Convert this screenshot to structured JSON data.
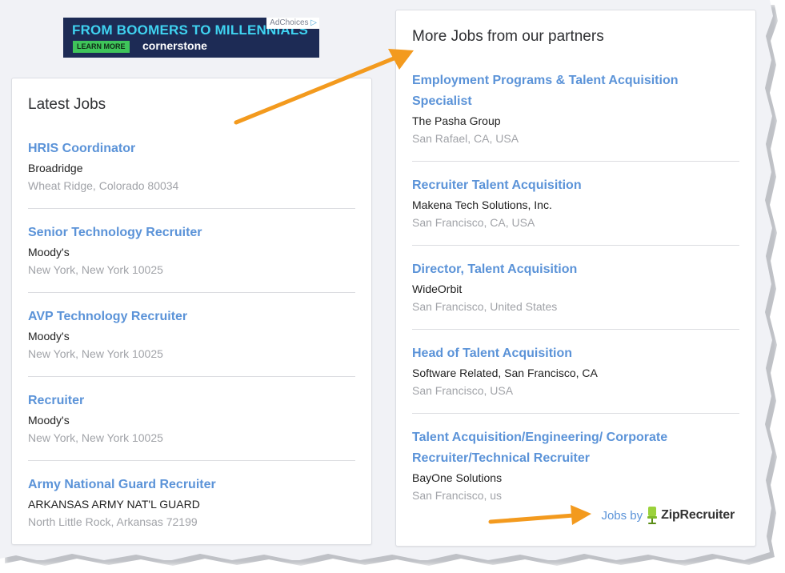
{
  "ad": {
    "headline": "FROM BOOMERS TO MILLENNIALS",
    "cta": "LEARN MORE",
    "brand": "cornerstone",
    "adchoices": "AdChoices"
  },
  "latest_jobs": {
    "title": "Latest Jobs",
    "jobs": [
      {
        "title": "HRIS Coordinator",
        "company": "Broadridge",
        "location": "Wheat Ridge, Colorado 80034"
      },
      {
        "title": "Senior Technology Recruiter",
        "company": "Moody's",
        "location": "New York, New York 10025"
      },
      {
        "title": "AVP Technology Recruiter",
        "company": "Moody's",
        "location": "New York, New York 10025"
      },
      {
        "title": "Recruiter",
        "company": "Moody's",
        "location": "New York, New York 10025"
      },
      {
        "title": "Army National Guard Recruiter",
        "company": "ARKANSAS ARMY NAT'L GUARD",
        "location": "North Little Rock, Arkansas 72199"
      }
    ]
  },
  "partner_jobs": {
    "title": "More Jobs from our partners",
    "jobs": [
      {
        "title": "Employment Programs & Talent Acquisition Specialist",
        "company": "The Pasha Group",
        "location": "San Rafael, CA, USA"
      },
      {
        "title": "Recruiter Talent Acquisition",
        "company": "Makena Tech Solutions, Inc.",
        "location": "San Francisco, CA, USA"
      },
      {
        "title": "Director, Talent Acquisition",
        "company": "WideOrbit",
        "location": "San Francisco, United States"
      },
      {
        "title": "Head of Talent Acquisition",
        "company": "Software Related, San Francisco, CA",
        "location": "San Francisco, USA"
      },
      {
        "title": "Talent Acquisition/Engineering/ Corporate Recruiter/Technical Recruiter",
        "company": "BayOne Solutions",
        "location": "San Francisco, us"
      }
    ],
    "powered_by": {
      "prefix": "Jobs by",
      "brand": "ZipRecruiter"
    }
  },
  "colors": {
    "link": "#5b93d8",
    "arrow": "#f39a1e",
    "ad_bg": "#1d2b55",
    "ad_headline": "#3fd2f0",
    "ad_cta": "#3fc55a"
  }
}
